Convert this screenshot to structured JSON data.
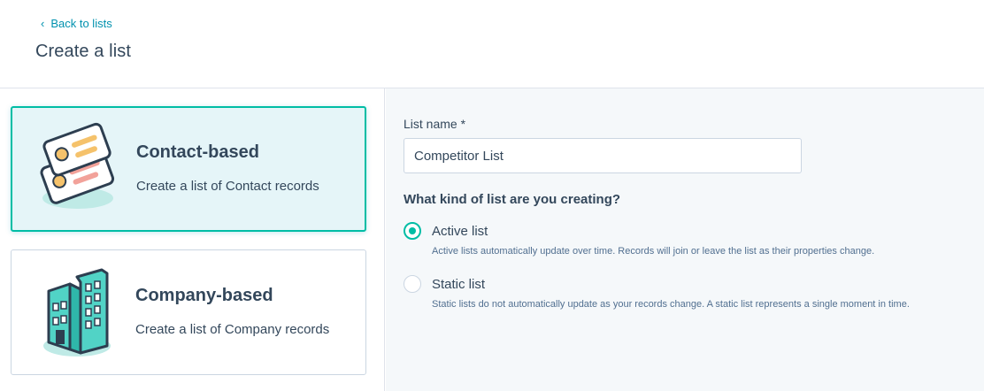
{
  "header": {
    "back_label": "Back to lists",
    "title": "Create a list"
  },
  "cards": [
    {
      "title": "Contact-based",
      "description": "Create a list of Contact records",
      "selected": true
    },
    {
      "title": "Company-based",
      "description": "Create a list of Company records",
      "selected": false
    }
  ],
  "form": {
    "name_label": "List name *",
    "name_value": "Competitor List",
    "question": "What kind of list are you creating?",
    "options": [
      {
        "label": "Active list",
        "help": "Active lists automatically update over time. Records will join or leave the list as their properties change.",
        "checked": true
      },
      {
        "label": "Static list",
        "help": "Static lists do not automatically update as your records change. A static list represents a single moment in time.",
        "checked": false
      }
    ]
  },
  "colors": {
    "accent": "#00bda5",
    "link": "#0091ae",
    "text": "#33475b",
    "selected_bg": "#e5f5f8"
  }
}
